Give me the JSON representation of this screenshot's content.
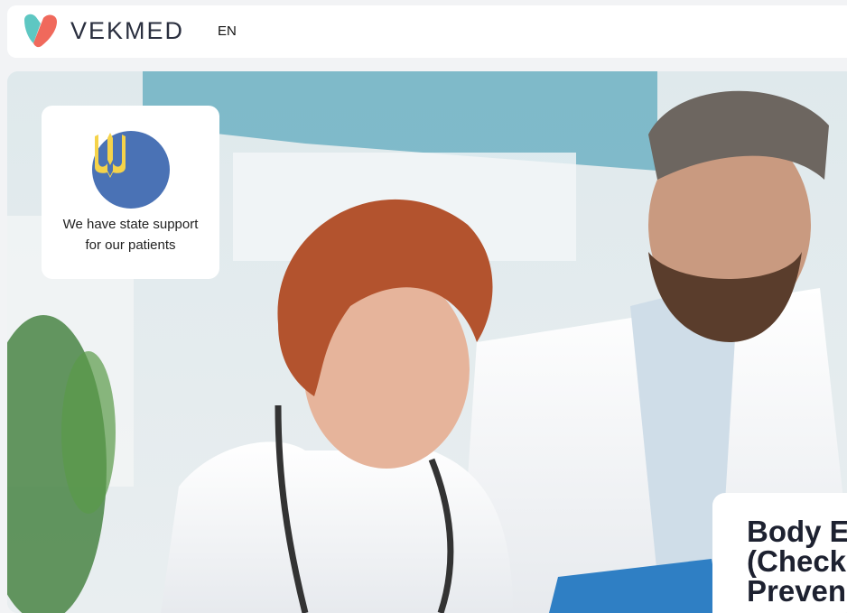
{
  "header": {
    "brand": "VEKMED",
    "language": "EN"
  },
  "hero": {
    "support_card": {
      "text_line1": "We have state support",
      "text_line2": "for our patients",
      "icon": "ukraine-trident-icon"
    },
    "service_card": {
      "title": "Body Ex\n(Check\nPreven"
    },
    "photo": "two-doctors-smiling"
  },
  "colors": {
    "logo_teal": "#5ec7c2",
    "logo_coral": "#f0695c",
    "crest_blue": "#4a72b5",
    "crest_gold": "#f5d34a"
  }
}
